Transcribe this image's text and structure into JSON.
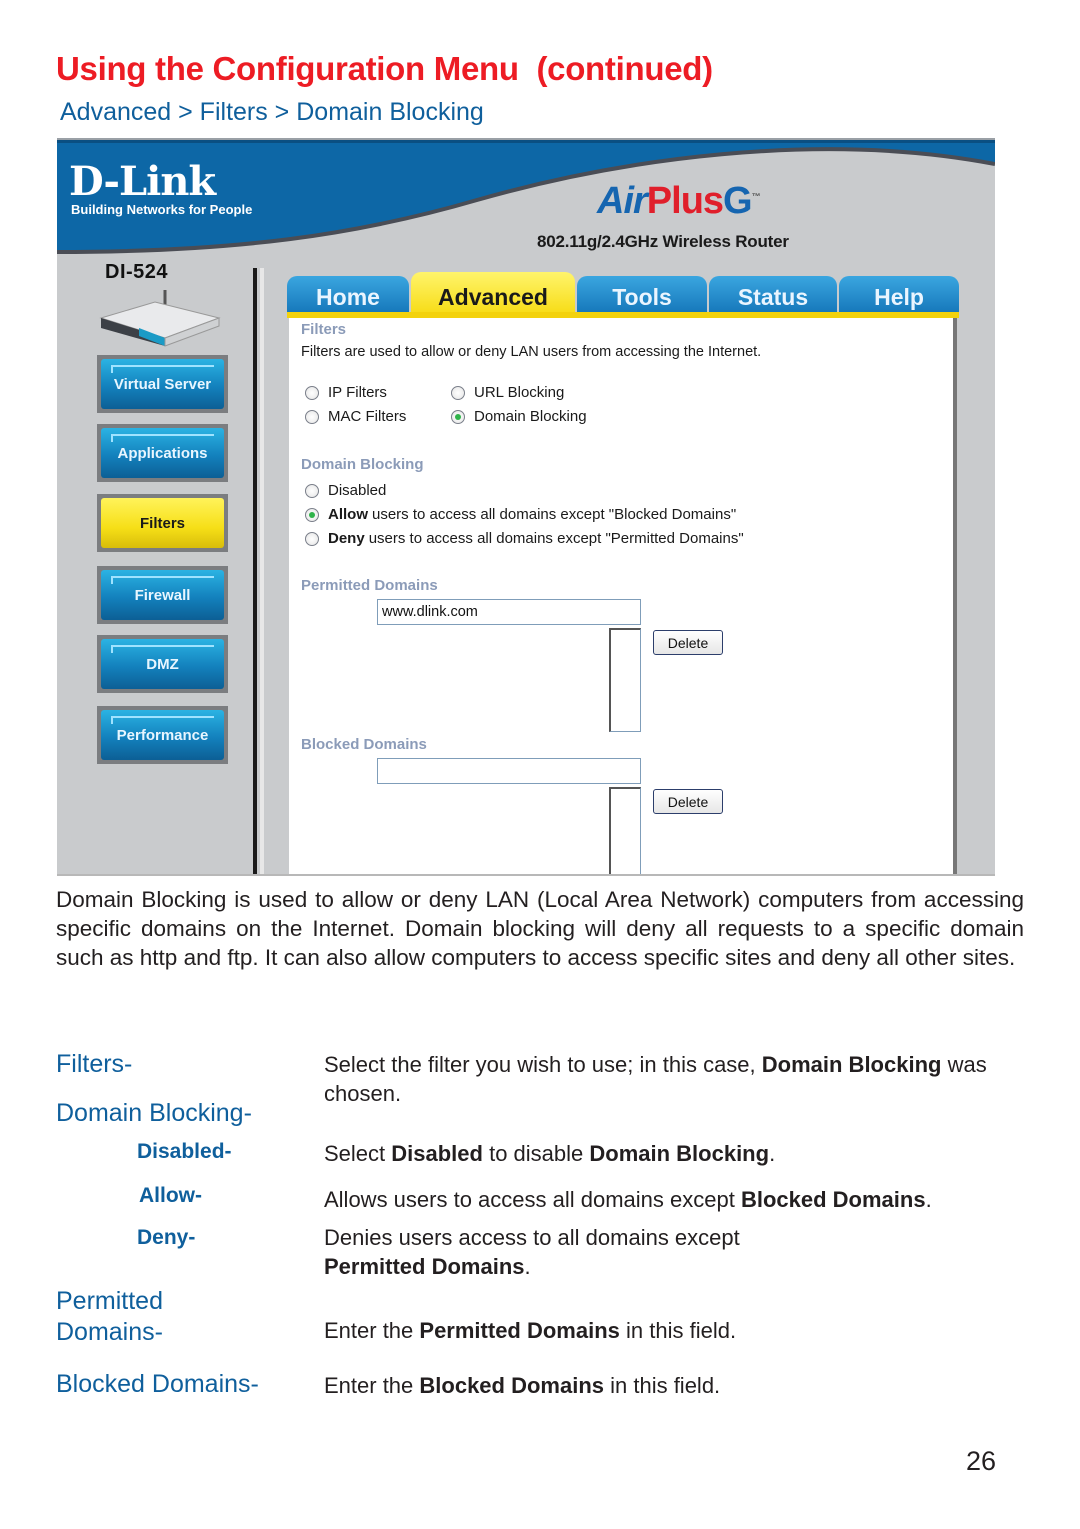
{
  "page": {
    "title": "Using the Configuration Menu  (continued)",
    "breadcrumb": "Advanced > Filters > Domain Blocking",
    "page_number": "26"
  },
  "colors": {
    "title_red": "#ed1c24",
    "heading_blue": "#0f5f9c",
    "tab_blue": "#1576b9",
    "tab_active_yellow": "#f7dc16",
    "section_label_gray_blue": "#8b9bb8",
    "radio_selected_green": "#2fb34a"
  },
  "screenshot": {
    "banner": {
      "brand": "D-Link",
      "tagline": "Building Networks for People",
      "product_air": "Air",
      "product_plus": "Plus",
      "product_g": "G",
      "trademark": "™",
      "router_description": "802.11g/2.4GHz Wireless Router"
    },
    "model": "DI-524",
    "sidebar": {
      "items": [
        {
          "label": "Virtual Server",
          "icon": "button",
          "active": false
        },
        {
          "label": "Applications",
          "icon": "button",
          "active": false
        },
        {
          "label": "Filters",
          "icon": "button",
          "active": true
        },
        {
          "label": "Firewall",
          "icon": "button",
          "active": false
        },
        {
          "label": "DMZ",
          "icon": "button",
          "active": false
        },
        {
          "label": "Performance",
          "icon": "button",
          "active": false
        }
      ]
    },
    "tabs": [
      {
        "label": "Home",
        "active": false
      },
      {
        "label": "Advanced",
        "active": true
      },
      {
        "label": "Tools",
        "active": false
      },
      {
        "label": "Status",
        "active": false
      },
      {
        "label": "Help",
        "active": false
      }
    ],
    "filters": {
      "heading": "Filters",
      "description": "Filters are used to allow or deny LAN users from accessing the Internet.",
      "options": [
        {
          "label": "IP Filters",
          "selected": false
        },
        {
          "label": "URL Blocking",
          "selected": false
        },
        {
          "label": "MAC Filters",
          "selected": false
        },
        {
          "label": "Domain Blocking",
          "selected": true
        }
      ]
    },
    "domain_blocking": {
      "heading": "Domain Blocking",
      "options": [
        {
          "bold": "",
          "label": "Disabled",
          "selected": false
        },
        {
          "bold": "Allow",
          "label": "users to access all domains except \"Blocked Domains\"",
          "selected": true
        },
        {
          "bold": "Deny",
          "label": "users to access all domains except \"Permitted Domains\"",
          "selected": false
        }
      ]
    },
    "permitted_domains": {
      "heading": "Permitted Domains",
      "input_value": "www.dlink.com",
      "delete_label": "Delete"
    },
    "blocked_domains": {
      "heading": "Blocked Domains",
      "input_value": "",
      "delete_label": "Delete"
    }
  },
  "intro": "Domain Blocking is used to allow or deny LAN (Local Area Network) computers from accessing specific domains on the Internet. Domain blocking will deny all requests to a specific domain such as http and ftp. It can also allow computers to access specific sites and deny all other sites.",
  "definitions": {
    "filters": {
      "term": "Filters-",
      "text_a": "Select the filter you wish to use; in this case, ",
      "bold_a": "Domain Blocking",
      "text_b": " was chosen."
    },
    "domain_blocking": {
      "term": "Domain Blocking-"
    },
    "disabled": {
      "term": "Disabled-",
      "text_a": "Select ",
      "bold_a": "Disabled",
      "text_b": " to disable ",
      "bold_b": "Domain Blocking",
      "text_c": "."
    },
    "allow": {
      "term": "Allow-",
      "text_a": "Allows users to access all domains except ",
      "bold_a": "Blocked Domains",
      "text_b": "."
    },
    "deny": {
      "term": "Deny-",
      "text_a": "Denies users  access to  all domains except",
      "bold_a": "Permitted Domains",
      "text_b": "."
    },
    "permitted": {
      "term_line1": "Permitted",
      "term_line2": "Domains-",
      "text_a": "Enter the ",
      "bold_a": "Permitted Domains",
      "text_b": " in this field."
    },
    "blocked": {
      "term": "Blocked Domains-",
      "text_a": "Enter the ",
      "bold_a": "Blocked Domains",
      "text_b": " in this field."
    }
  }
}
